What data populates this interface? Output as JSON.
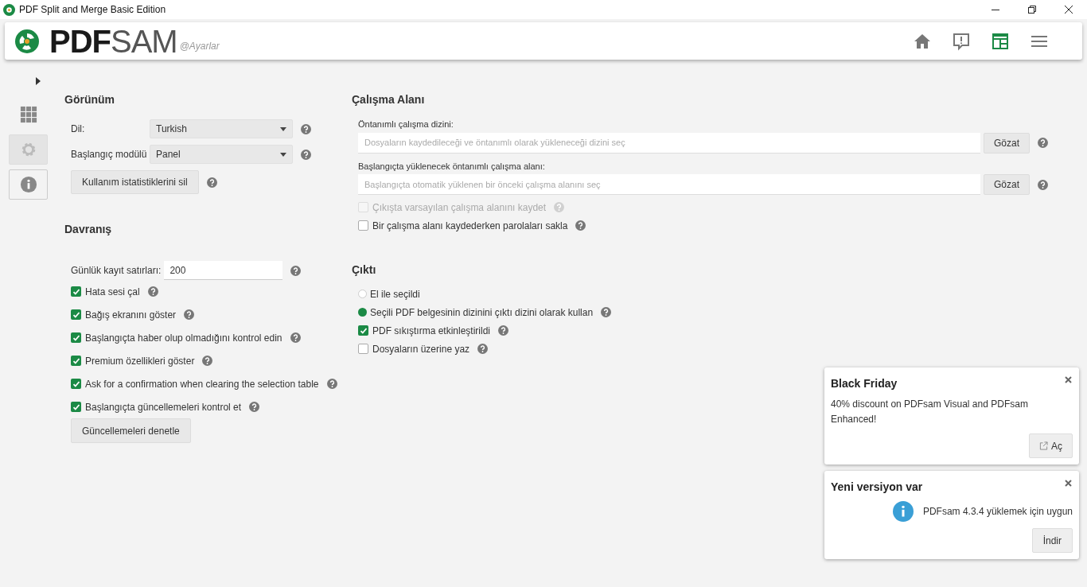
{
  "window": {
    "title": "PDF Split and Merge Basic Edition"
  },
  "header": {
    "logo_dark": "PDF",
    "logo_light": "SAM",
    "context": "@Ayarlar",
    "buttons": [
      {
        "kind": "home",
        "selected": false
      },
      {
        "kind": "feedback",
        "selected": false
      },
      {
        "kind": "dashboard",
        "selected": true
      },
      {
        "kind": "menu",
        "selected": false
      }
    ]
  },
  "sidebar": {
    "items": [
      {
        "kind": "grid",
        "selected": false
      },
      {
        "kind": "settings",
        "selected": true
      },
      {
        "kind": "info",
        "selected": false
      }
    ]
  },
  "appearance": {
    "title": "Görünüm",
    "selects": [
      {
        "label": "Dil:",
        "value": "Turkish"
      },
      {
        "label": "Başlangıç modülü",
        "value": "Panel"
      }
    ],
    "button": "Kullanım istatistiklerini sil"
  },
  "behavior": {
    "title": "Davranış",
    "log_label": "Günlük kayıt satırları:",
    "log_value": "200",
    "checkboxes": [
      {
        "label": "Hata sesi çal",
        "checked": true
      },
      {
        "label": "Bağış ekranını göster",
        "checked": true
      },
      {
        "label": "Başlangıçta haber olup olmadığını kontrol edin",
        "checked": true
      },
      {
        "label": "Premium özellikleri göster",
        "checked": true
      },
      {
        "label": "Ask for a confirmation when clearing the selection table",
        "checked": true
      },
      {
        "label": "Başlangıçta güncellemeleri kontrol et",
        "checked": true
      }
    ],
    "button": "Güncellemeleri denetle"
  },
  "workspace": {
    "title": "Çalışma Alanı",
    "fields": [
      {
        "label": "Öntanımlı çalışma dizini:",
        "placeholder": "Dosyaların kaydedileceği ve öntanımlı olarak yükleneceği dizini seç",
        "button": "Gözat"
      },
      {
        "label": "Başlangıçta yüklenecek öntanımlı çalışma alanı:",
        "placeholder": "Başlangıçta otomatik yüklenen bir önceki çalışma alanını seç",
        "button": "Gözat"
      }
    ],
    "checkboxes": [
      {
        "label": "Çıkışta varsayılan çalışma alanını kaydet",
        "checked": false,
        "disabled": true
      },
      {
        "label": "Bir çalışma alanı kaydederken parolaları sakla",
        "checked": false,
        "disabled": false
      }
    ]
  },
  "output": {
    "title": "Çıktı",
    "options": [
      {
        "kind": "radio",
        "label": "El ile seçildi",
        "selected": false,
        "help": false
      },
      {
        "kind": "radio",
        "label": "Seçili PDF belgesinin dizinini çıktı dizini olarak kullan",
        "selected": true,
        "help": true
      },
      {
        "kind": "checkbox",
        "label": "PDF sıkıştırma etkinleştirildi",
        "checked": true,
        "help": true
      },
      {
        "kind": "checkbox",
        "label": "Dosyaların üzerine yaz",
        "checked": false,
        "help": true
      }
    ]
  },
  "notifications": [
    {
      "kind": "promo",
      "title": "Black Friday",
      "message": "40% discount on PDFsam Visual and PDFsam Enhanced!",
      "button": "Aç"
    },
    {
      "kind": "update",
      "title": "Yeni versiyon var",
      "message": "PDFsam 4.3.4 yüklemek için uygun",
      "button": "İndir"
    }
  ]
}
